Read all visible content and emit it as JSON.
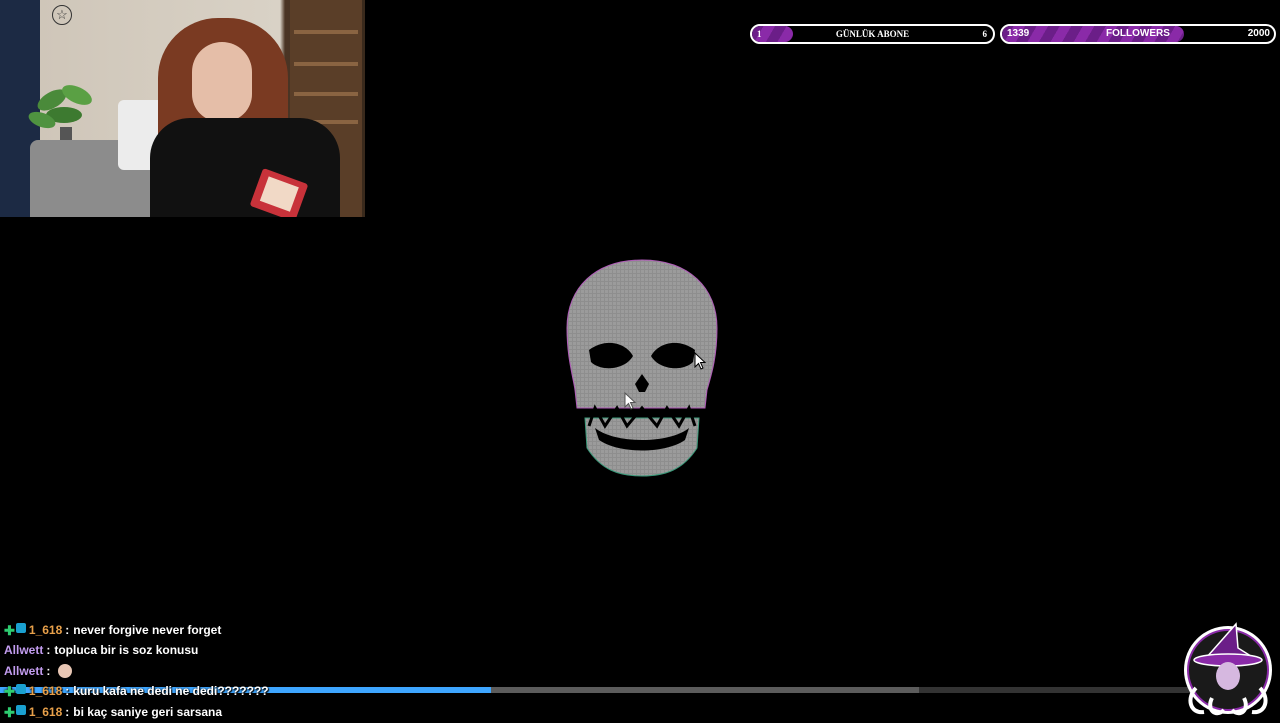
{
  "webcam": {
    "label": "webcam-feed"
  },
  "goals": {
    "abone": {
      "start": "1",
      "label": "GÜNLÜK ABONE",
      "target": "6",
      "progress": 0.17
    },
    "followers": {
      "current": "1339",
      "label": "FOLLOWERS",
      "target": "2000",
      "progress": 0.67
    }
  },
  "colors": {
    "accent": "#8a2aa8",
    "progress": "#3ea6ff",
    "user_orange": "#e8a04a",
    "user_purple": "#c39df0"
  },
  "chat": [
    {
      "user": "1_618",
      "text": "never forgive never forget",
      "badges": true
    },
    {
      "user": "Allwett",
      "text": "topluca bir is soz konusu",
      "badges": false
    },
    {
      "user": "Allwett",
      "text": "",
      "badges": false,
      "emote": true
    },
    {
      "user": "1_618",
      "text": "kuru kafa ne dedi ne dedi???????",
      "badges": true
    },
    {
      "user": "1_618",
      "text": "bi kaç saniye geri sarsana",
      "badges": true
    }
  ],
  "video": {
    "played_fraction": 0.409,
    "buffered_fraction": 0.766
  }
}
